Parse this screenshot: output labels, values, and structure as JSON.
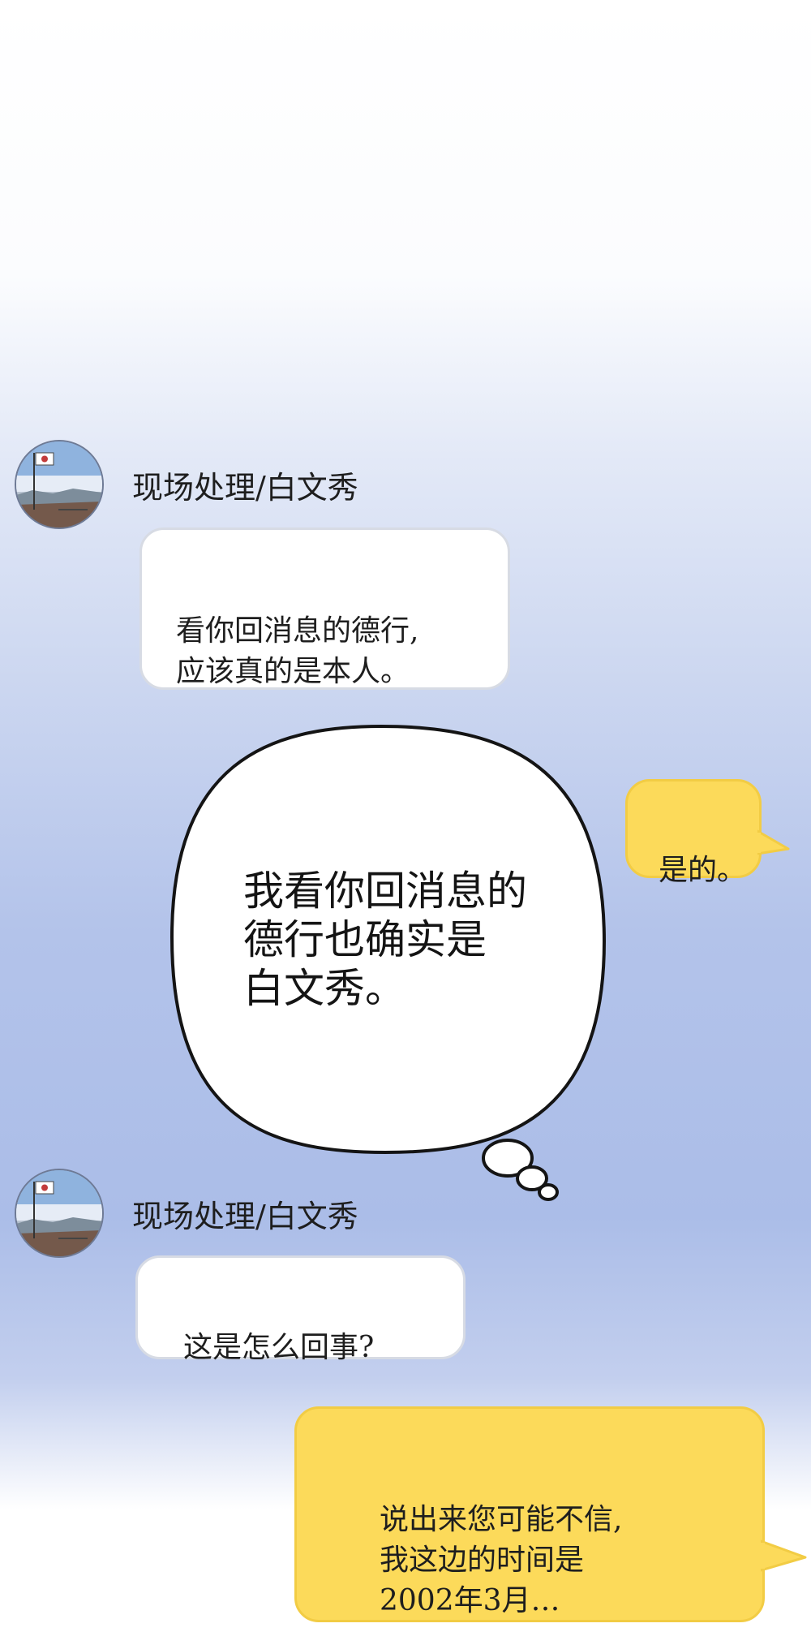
{
  "messages": [
    {
      "sender": "现场处理/白文秀",
      "text": "看你回消息的德行,\n应该真的是本人。"
    },
    {
      "text": "是的。"
    },
    {
      "sender": "现场处理/白文秀",
      "text": "这是怎么回事?"
    },
    {
      "text": "说出来您可能不信,\n我这边的时间是\n2002年3月…"
    }
  ],
  "thought": {
    "text": "我看你回消息的\n德行也确实是\n白文秀。"
  },
  "colors": {
    "incoming_bubble": "#ffffff",
    "outgoing_bubble": "#fcda5a",
    "thought_outline": "#141414"
  }
}
